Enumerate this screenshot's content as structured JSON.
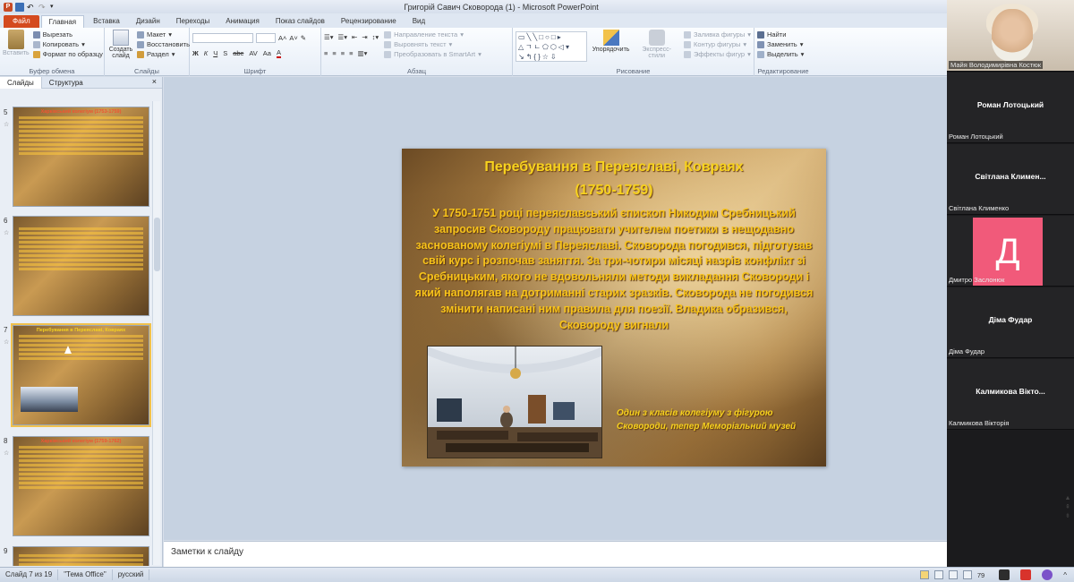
{
  "window": {
    "title": "Григорій Савич Сковорода (1) - Microsoft PowerPoint"
  },
  "tabs": [
    {
      "label": "Файл"
    },
    {
      "label": "Главная"
    },
    {
      "label": "Вставка"
    },
    {
      "label": "Дизайн"
    },
    {
      "label": "Переходы"
    },
    {
      "label": "Анимация"
    },
    {
      "label": "Показ слайдов"
    },
    {
      "label": "Рецензирование"
    },
    {
      "label": "Вид"
    }
  ],
  "ribbon": {
    "clipboard": {
      "label": "Буфер обмена",
      "paste": "Вставить",
      "cut": "Вырезать",
      "copy": "Копировать",
      "format_painter": "Формат по образцу"
    },
    "slides": {
      "label": "Слайды",
      "new_slide": "Создать слайд",
      "layout": "Макет",
      "reset": "Восстановить",
      "section": "Раздел"
    },
    "font": {
      "label": "Шрифт",
      "styles": [
        "Ж",
        "К",
        "Ч",
        "S",
        "abc",
        "AV",
        "Aa",
        "A"
      ]
    },
    "paragraph": {
      "label": "Абзац",
      "text_direction": "Направление текста",
      "align_text": "Выровнять текст",
      "smartart": "Преобразовать в SmartArt"
    },
    "drawing": {
      "label": "Рисование",
      "arrange": "Упорядочить",
      "quick_styles": "Экспресс-стили",
      "shape_fill": "Заливка фигуры",
      "shape_outline": "Контур фигуры",
      "shape_effects": "Эффекты фигур"
    },
    "editing": {
      "label": "Редактирование",
      "find": "Найти",
      "replace": "Заменить",
      "select": "Выделить"
    }
  },
  "left_pane": {
    "tabs": [
      {
        "label": "Слайды"
      },
      {
        "label": "Структура"
      }
    ],
    "close": "×",
    "thumbnails": [
      {
        "number": "5",
        "title": "Харківський колегіум (1753-1759)",
        "selected": false
      },
      {
        "number": "6",
        "title": "",
        "selected": false
      },
      {
        "number": "7",
        "title": "Перебування в Переяславі, Ковраях",
        "selected": true
      },
      {
        "number": "8",
        "title": "Харківський колегіум (1759-1762)",
        "selected": false
      },
      {
        "number": "9",
        "title": "",
        "selected": false
      }
    ]
  },
  "slide": {
    "title_line1": "Перебування в Переяславі, Ковраях",
    "title_line2": "(1750-1759)",
    "body": "У 1750-1751 році переяславський єпископ Никодим Сребницький запросив Сковороду працювати учителем поетики в нещодавно заснованому колегіумі в Переяславі. Сковорода погодився, підготував свій курс і розпочав заняття. За три-чотири місяці назрів конфлікт зі Сребницьким, якого не вдовольняли методи викладання Сковороди і який наполягав на дотриманні старих зразків. Сковорода не погодився змінити написані ним правила для поезії. Владика образився, Сковороду вигнали",
    "caption": "Один з класів колегіуму з фігурою Сковороди, тепер Меморіальний музей"
  },
  "notes": {
    "placeholder": "Заметки к слайду"
  },
  "status": {
    "slide_info": "Слайд 7 из 19",
    "theme": "\"Тема Office\"",
    "language": "русский",
    "zoom": "79"
  },
  "participants": [
    {
      "display": "",
      "label": "Майя Володимирівна Костюк",
      "type": "video"
    },
    {
      "display": "Роман Лотоцький",
      "label": "Роман Лотоцький",
      "type": "name"
    },
    {
      "display": "Світлана Климен...",
      "label": "Світлана Клименко",
      "type": "name"
    },
    {
      "display": "Д",
      "label": "Дмитро Заслонюк",
      "type": "avatar",
      "color": "#f15a7a"
    },
    {
      "display": "Діма Фудар",
      "label": "Діма Фудар",
      "type": "name"
    },
    {
      "display": "Калмикова Вікто...",
      "label": "Калмикова Вікторія",
      "type": "name"
    }
  ]
}
